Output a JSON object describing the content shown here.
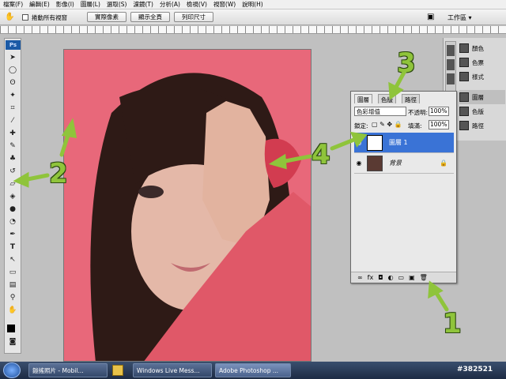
{
  "menu": [
    "檔案(F)",
    "編輯(E)",
    "影像(I)",
    "圖層(L)",
    "選取(S)",
    "濾鏡(T)",
    "分析(A)",
    "檢視(V)",
    "視窗(W)",
    "說明(H)"
  ],
  "options": {
    "scroll_all": "捲動所有視窗",
    "actual_pixels": "實際像素",
    "fit_screen": "顯示全頁",
    "print_size": "列印尺寸",
    "workspace": "工作區 ▾"
  },
  "right_panels": [
    "顏色",
    "色票",
    "樣式",
    "圖層",
    "色版",
    "路徑"
  ],
  "layers_panel": {
    "tabs": [
      "圖層",
      "色版",
      "路徑"
    ],
    "blend_mode": "色彩增值",
    "opacity_label": "不透明:",
    "opacity_value": "100%",
    "lock_label": "鎖定:",
    "fill_label": "填滿:",
    "fill_value": "100%",
    "layers": [
      {
        "name": "圖層 1",
        "selected": true
      },
      {
        "name": "背景",
        "selected": false
      }
    ]
  },
  "taskbar": {
    "items": [
      "鎧搖照片 - Mobil...",
      "Windows Live Mess...",
      "Adobe Photoshop ..."
    ],
    "watermark": "#382521"
  },
  "callouts": [
    "1",
    "2",
    "3",
    "4"
  ],
  "colors": {
    "canvas_bg": "#e8687a",
    "layer_selected": "#3a73d6",
    "callout": "#8fc43b"
  }
}
